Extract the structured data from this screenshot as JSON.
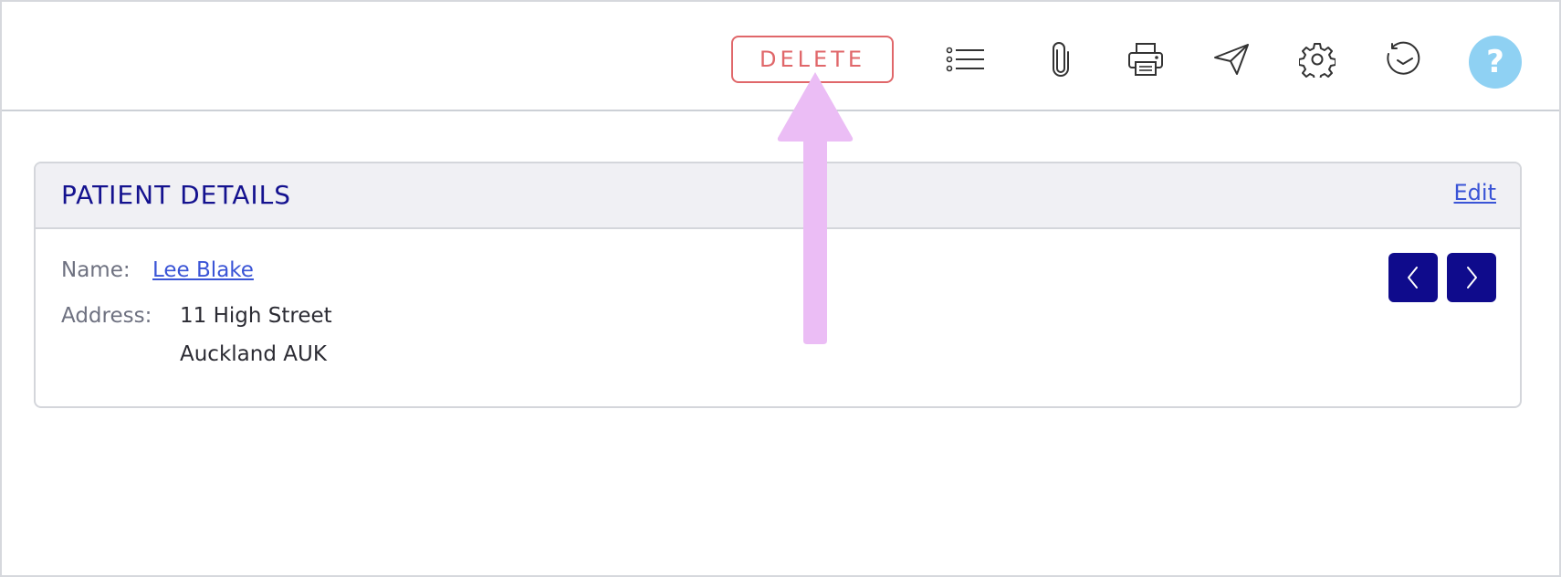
{
  "toolbar": {
    "delete_label": "DELETE",
    "icons": [
      "list-icon",
      "paperclip-icon",
      "printer-icon",
      "send-icon",
      "gear-icon",
      "history-icon"
    ],
    "help_label": "?"
  },
  "patient_card": {
    "title": "PATIENT DETAILS",
    "edit_label": "Edit",
    "name_label": "Name:",
    "name_value": "Lee Blake",
    "address_label": "Address:",
    "address_line1": "11 High Street",
    "address_line2": "Auckland AUK"
  },
  "colors": {
    "delete": "#e0676a",
    "title": "#14128f",
    "link": "#3a54d6",
    "nav_button": "#0f0b8c",
    "help": "#8fd1f3",
    "annotation_arrow": "#ebbdf5"
  }
}
